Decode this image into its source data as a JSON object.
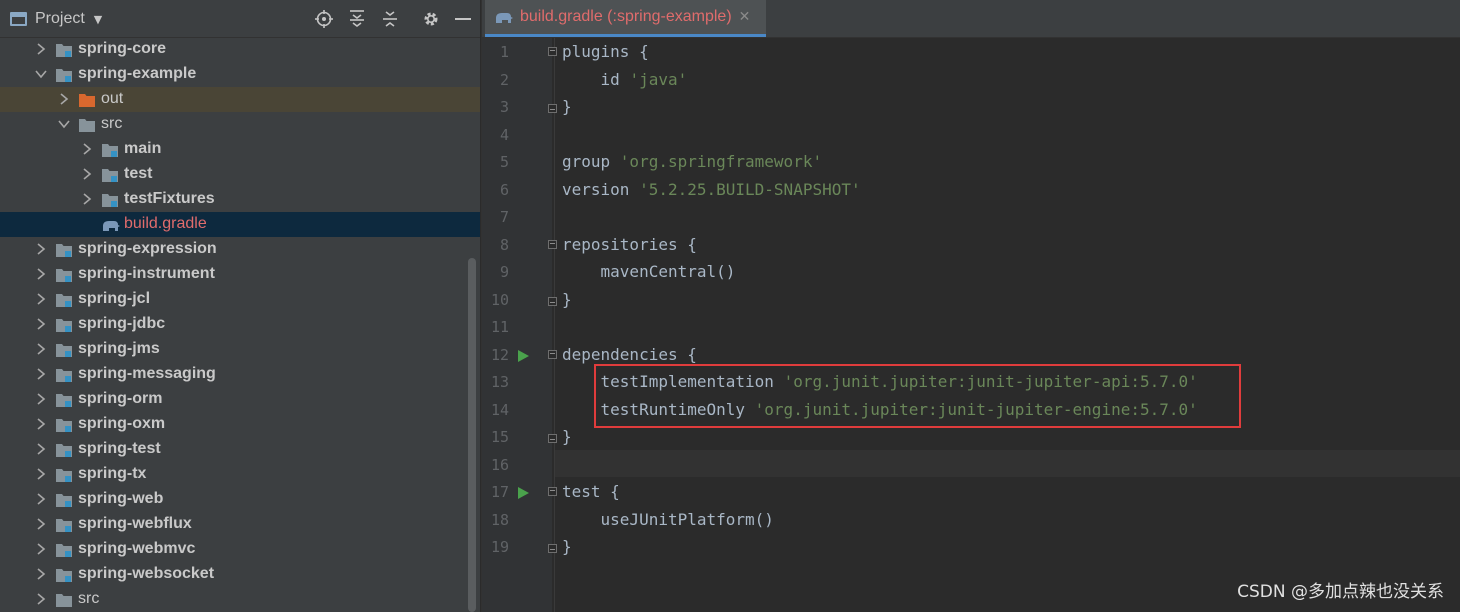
{
  "project_panel": {
    "title": "Project",
    "tree": [
      {
        "label": "spring-core",
        "kind": "module",
        "expanded": false,
        "level": 1
      },
      {
        "label": "spring-example",
        "kind": "module",
        "expanded": true,
        "level": 1
      },
      {
        "label": "out",
        "kind": "excluded-folder",
        "expanded": false,
        "level": 2
      },
      {
        "label": "src",
        "kind": "folder",
        "expanded": true,
        "level": 2
      },
      {
        "label": "main",
        "kind": "source-folder",
        "expanded": false,
        "level": 3
      },
      {
        "label": "test",
        "kind": "source-folder",
        "expanded": false,
        "level": 3
      },
      {
        "label": "testFixtures",
        "kind": "source-folder",
        "expanded": false,
        "level": 3
      },
      {
        "label": "build.gradle",
        "kind": "gradle-file",
        "level": 3,
        "selected": true
      },
      {
        "label": "spring-expression",
        "kind": "module",
        "expanded": false,
        "level": 1
      },
      {
        "label": "spring-instrument",
        "kind": "module",
        "expanded": false,
        "level": 1
      },
      {
        "label": "spring-jcl",
        "kind": "module",
        "expanded": false,
        "level": 1
      },
      {
        "label": "spring-jdbc",
        "kind": "module",
        "expanded": false,
        "level": 1
      },
      {
        "label": "spring-jms",
        "kind": "module",
        "expanded": false,
        "level": 1
      },
      {
        "label": "spring-messaging",
        "kind": "module",
        "expanded": false,
        "level": 1
      },
      {
        "label": "spring-orm",
        "kind": "module",
        "expanded": false,
        "level": 1
      },
      {
        "label": "spring-oxm",
        "kind": "module",
        "expanded": false,
        "level": 1
      },
      {
        "label": "spring-test",
        "kind": "module",
        "expanded": false,
        "level": 1
      },
      {
        "label": "spring-tx",
        "kind": "module",
        "expanded": false,
        "level": 1
      },
      {
        "label": "spring-web",
        "kind": "module",
        "expanded": false,
        "level": 1
      },
      {
        "label": "spring-webflux",
        "kind": "module",
        "expanded": false,
        "level": 1
      },
      {
        "label": "spring-webmvc",
        "kind": "module",
        "expanded": false,
        "level": 1
      },
      {
        "label": "spring-websocket",
        "kind": "module",
        "expanded": false,
        "level": 1
      },
      {
        "label": "src",
        "kind": "folder",
        "expanded": false,
        "level": 1
      }
    ]
  },
  "editor": {
    "tab": {
      "label": "build.gradle (:spring-example)",
      "close": "✕"
    },
    "current_line": 16,
    "lines": [
      {
        "n": "1",
        "tokens": [
          {
            "t": "plugins {",
            "c": "plain"
          }
        ],
        "fold": "open"
      },
      {
        "n": "2",
        "tokens": [
          {
            "t": "    id ",
            "c": "plain"
          },
          {
            "t": "'java'",
            "c": "str"
          }
        ]
      },
      {
        "n": "3",
        "tokens": [
          {
            "t": "}",
            "c": "plain"
          }
        ],
        "fold": "close"
      },
      {
        "n": "4",
        "tokens": []
      },
      {
        "n": "5",
        "tokens": [
          {
            "t": "group ",
            "c": "plain"
          },
          {
            "t": "'org.springframework'",
            "c": "str"
          }
        ]
      },
      {
        "n": "6",
        "tokens": [
          {
            "t": "version ",
            "c": "plain"
          },
          {
            "t": "'5.2.25.BUILD-SNAPSHOT'",
            "c": "str"
          }
        ]
      },
      {
        "n": "7",
        "tokens": []
      },
      {
        "n": "8",
        "tokens": [
          {
            "t": "repositories {",
            "c": "plain"
          }
        ],
        "fold": "open"
      },
      {
        "n": "9",
        "tokens": [
          {
            "t": "    mavenCentral()",
            "c": "plain"
          }
        ]
      },
      {
        "n": "10",
        "tokens": [
          {
            "t": "}",
            "c": "plain"
          }
        ],
        "fold": "close"
      },
      {
        "n": "11",
        "tokens": []
      },
      {
        "n": "12",
        "tokens": [
          {
            "t": "dependencies {",
            "c": "plain"
          }
        ],
        "fold": "open",
        "run": true
      },
      {
        "n": "13",
        "tokens": [
          {
            "t": "    testImplementation ",
            "c": "plain"
          },
          {
            "t": "'org.junit.jupiter:junit-jupiter-api:5.7.0'",
            "c": "str"
          }
        ]
      },
      {
        "n": "14",
        "tokens": [
          {
            "t": "    testRuntimeOnly ",
            "c": "plain"
          },
          {
            "t": "'org.junit.jupiter:junit-jupiter-engine:5.7.0'",
            "c": "str"
          }
        ]
      },
      {
        "n": "15",
        "tokens": [
          {
            "t": "}",
            "c": "plain"
          }
        ],
        "fold": "close"
      },
      {
        "n": "16",
        "tokens": []
      },
      {
        "n": "17",
        "tokens": [
          {
            "t": "test {",
            "c": "plain"
          }
        ],
        "fold": "open",
        "run": true
      },
      {
        "n": "18",
        "tokens": [
          {
            "t": "    useJUnitPlatform()",
            "c": "plain"
          }
        ]
      },
      {
        "n": "19",
        "tokens": [
          {
            "t": "}",
            "c": "plain"
          }
        ],
        "fold": "close"
      }
    ]
  },
  "watermark": "CSDN @多加点辣也没关系",
  "colors": {
    "panel_bg": "#3c3f41",
    "editor_bg": "#2b2b2b",
    "string": "#6a8759",
    "code": "#a9b7c6",
    "gradle_red": "#e06c6c",
    "highlight_box": "#e03c3c",
    "run_green": "#4aa24c"
  }
}
